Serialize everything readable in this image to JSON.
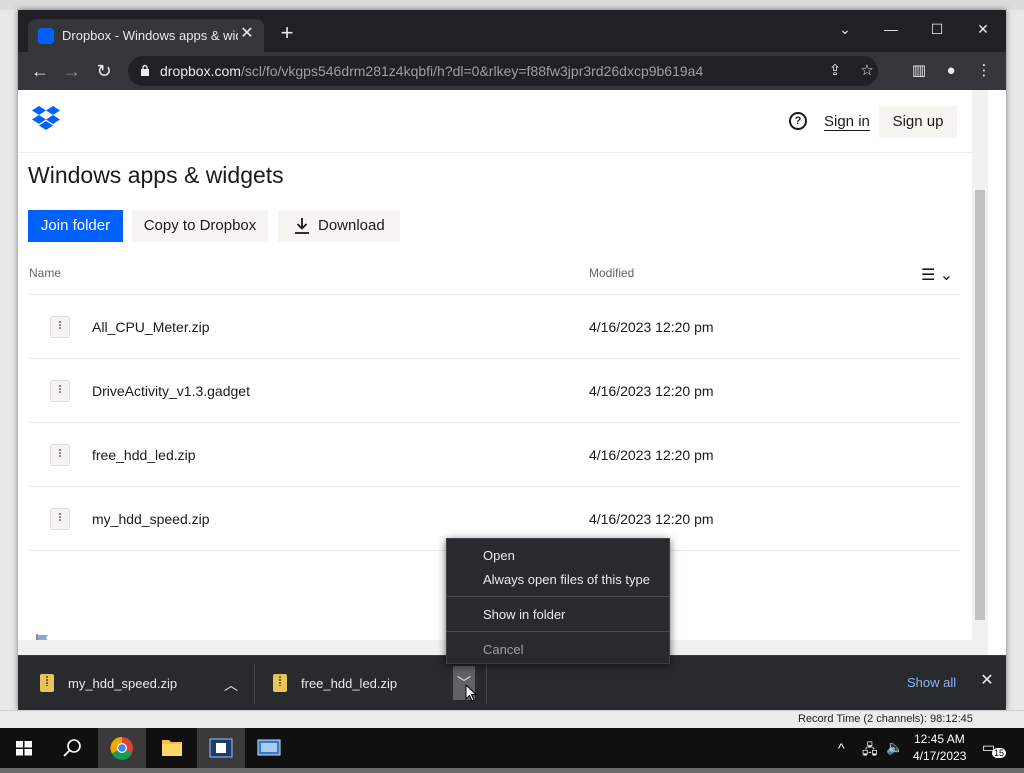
{
  "browser": {
    "tab_title": "Dropbox - Windows apps & widgets",
    "url_domain": "dropbox.com",
    "url_path": "/scl/fo/vkgps546drm281z4kqbfi/h?dl=0&rlkey=f88fw3jpr3rd26dxcp9b619a4"
  },
  "header": {
    "signin_label": "Sign in",
    "signup_label": "Sign up"
  },
  "folder": {
    "title": "Windows apps & widgets",
    "join_label": "Join folder",
    "copy_label": "Copy to Dropbox",
    "download_label": "Download",
    "col_name": "Name",
    "col_modified": "Modified"
  },
  "files": [
    {
      "name": "All_CPU_Meter.zip",
      "modified": "4/16/2023 12:20 pm"
    },
    {
      "name": "DriveActivity_v1.3.gadget",
      "modified": "4/16/2023 12:20 pm"
    },
    {
      "name": "free_hdd_led.zip",
      "modified": "4/16/2023 12:20 pm"
    },
    {
      "name": "my_hdd_speed.zip",
      "modified": "4/16/2023 12:20 pm"
    }
  ],
  "context_menu": {
    "open": "Open",
    "always_open": "Always open files of this type",
    "show_in_folder": "Show in folder",
    "cancel": "Cancel"
  },
  "downloads": {
    "item1": "my_hdd_speed.zip",
    "item2": "free_hdd_led.zip",
    "show_all": "Show all"
  },
  "record_time": "Record Time (2 channels): 98:12:45",
  "taskbar": {
    "time": "12:45 AM",
    "date": "4/17/2023",
    "notifications": "15"
  },
  "colors": {
    "dropbox_blue": "#0061fe",
    "chrome_dark": "#202124",
    "link_blue": "#8ab4f8"
  }
}
